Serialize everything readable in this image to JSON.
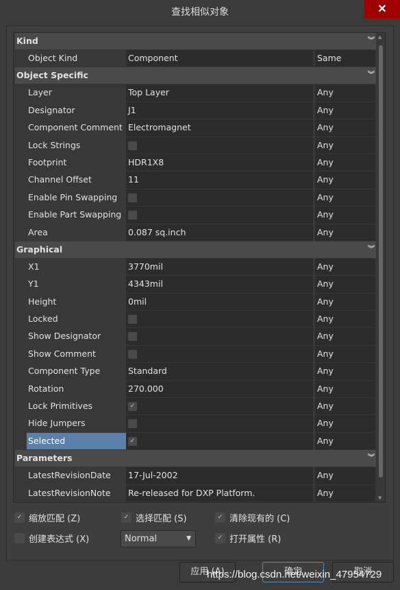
{
  "window": {
    "title": "查找相似对象",
    "close_icon": "close-icon"
  },
  "sections": [
    {
      "title": "Kind",
      "rows": [
        {
          "label": "Object Kind",
          "value": "Component",
          "qualifier": "Same"
        }
      ]
    },
    {
      "title": "Object Specific",
      "rows": [
        {
          "label": "Layer",
          "value": "Top Layer",
          "qualifier": "Any"
        },
        {
          "label": "Designator",
          "value": "J1",
          "qualifier": "Any"
        },
        {
          "label": "Component Comment",
          "value": "Electromagnet",
          "qualifier": "Any"
        },
        {
          "label": "Lock Strings",
          "checkbox": false,
          "qualifier": "Any"
        },
        {
          "label": "Footprint",
          "value": "HDR1X8",
          "qualifier": "Any"
        },
        {
          "label": "Channel Offset",
          "value": "11",
          "qualifier": "Any"
        },
        {
          "label": "Enable Pin Swapping",
          "checkbox": false,
          "qualifier": "Any"
        },
        {
          "label": "Enable Part Swapping",
          "checkbox": false,
          "qualifier": "Any"
        },
        {
          "label": "Area",
          "value": "0.087 sq.inch",
          "qualifier": "Any"
        }
      ]
    },
    {
      "title": "Graphical",
      "rows": [
        {
          "label": "X1",
          "value": "3770mil",
          "qualifier": "Any"
        },
        {
          "label": "Y1",
          "value": "4343mil",
          "qualifier": "Any"
        },
        {
          "label": "Height",
          "value": "0mil",
          "qualifier": "Any"
        },
        {
          "label": "Locked",
          "checkbox": false,
          "qualifier": "Any"
        },
        {
          "label": "Show Designator",
          "checkbox": false,
          "qualifier": "Any"
        },
        {
          "label": "Show Comment",
          "checkbox": false,
          "qualifier": "Any"
        },
        {
          "label": "Component Type",
          "value": "Standard",
          "qualifier": "Any"
        },
        {
          "label": "Rotation",
          "value": "270.000",
          "qualifier": "Any"
        },
        {
          "label": "Lock Primitives",
          "checkbox": true,
          "qualifier": "Any"
        },
        {
          "label": "Hide Jumpers",
          "checkbox": false,
          "qualifier": "Any"
        },
        {
          "label": "Selected",
          "checkbox": true,
          "qualifier": "Any",
          "highlighted": true
        }
      ]
    },
    {
      "title": "Parameters",
      "rows": [
        {
          "label": "LatestRevisionDate",
          "value": "17-Jul-2002",
          "qualifier": "Any"
        },
        {
          "label": "LatestRevisionNote",
          "value": "Re-released for DXP Platform.",
          "qualifier": "Any"
        },
        {
          "label": "",
          "value": "",
          "qualifier": ""
        }
      ]
    }
  ],
  "options": {
    "zoom": {
      "label": "缩放匹配 (Z)",
      "checked": true
    },
    "select": {
      "label": "选择匹配 (S)",
      "checked": true
    },
    "clear": {
      "label": "清除现有的 (C)",
      "checked": true
    },
    "expr": {
      "label": "创建表达式 (X)",
      "checked": false
    },
    "inspect": {
      "label": "打开属性 (R)",
      "checked": true
    },
    "mode": "Normal"
  },
  "buttons": {
    "apply": "应用 (A)",
    "ok": "确定",
    "cancel": "取消"
  },
  "watermark": "https://blog.csdn.net/weixin_47954729",
  "colors": {
    "selection": "#5a7fa8",
    "close": "#a00000"
  }
}
